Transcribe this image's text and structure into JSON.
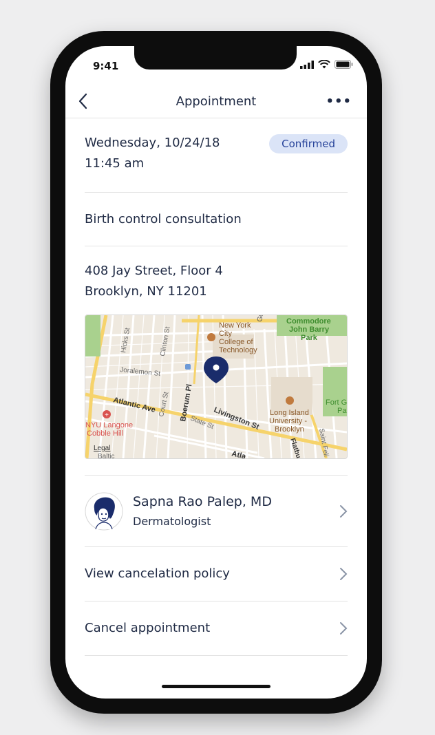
{
  "status_bar": {
    "time": "9:41"
  },
  "navbar": {
    "title": "Appointment"
  },
  "appointment": {
    "date": "Wednesday, 10/24/18",
    "time": "11:45 am",
    "status": "Confirmed",
    "reason": "Birth control consultation",
    "address_line1": "408 Jay Street, Floor 4",
    "address_line2": "Brooklyn, NY 11201"
  },
  "map": {
    "labels": {
      "commodore": "Commodore",
      "john_barry": "John Barry",
      "park": "Park",
      "new_york": "New York",
      "city": "City",
      "college_of": "College of",
      "technology": "Technology",
      "hicks": "Hicks St",
      "clinton": "Clinton St",
      "joralemon": "Joralemon St",
      "atlantic": "Atlantic Ave",
      "court": "Court St",
      "boerum": "Boerum Pl",
      "state": "State St",
      "livingston": "Livingston St",
      "nyu1": "NYU Langone",
      "nyu2": "Cobble Hill",
      "liu1": "Long Island",
      "liu2": "University -",
      "liu3": "Brooklyn",
      "fort1": "Fort G",
      "fort2": "Pa",
      "flatbush": "Flatbu",
      "saint": "Saint Feli",
      "legal": "Legal",
      "atl2": "Atla",
      "baltic": "Baltic",
      "go": "Go"
    },
    "colors": {
      "pin": "#1a2c6b",
      "park": "#a9d18e",
      "major_road": "#f6d36b",
      "hospital": "#d9534f",
      "college": "#c07a3e"
    }
  },
  "doctor": {
    "name": "Sapna Rao Palep, MD",
    "specialty": "Dermatologist"
  },
  "actions": {
    "cancel_policy": "View cancelation policy",
    "cancel_appt": "Cancel appointment"
  },
  "colors": {
    "accent": "#27439a",
    "badge_bg": "#dbe4f7",
    "text": "#1f2a44",
    "divider": "#e3e3e3"
  }
}
